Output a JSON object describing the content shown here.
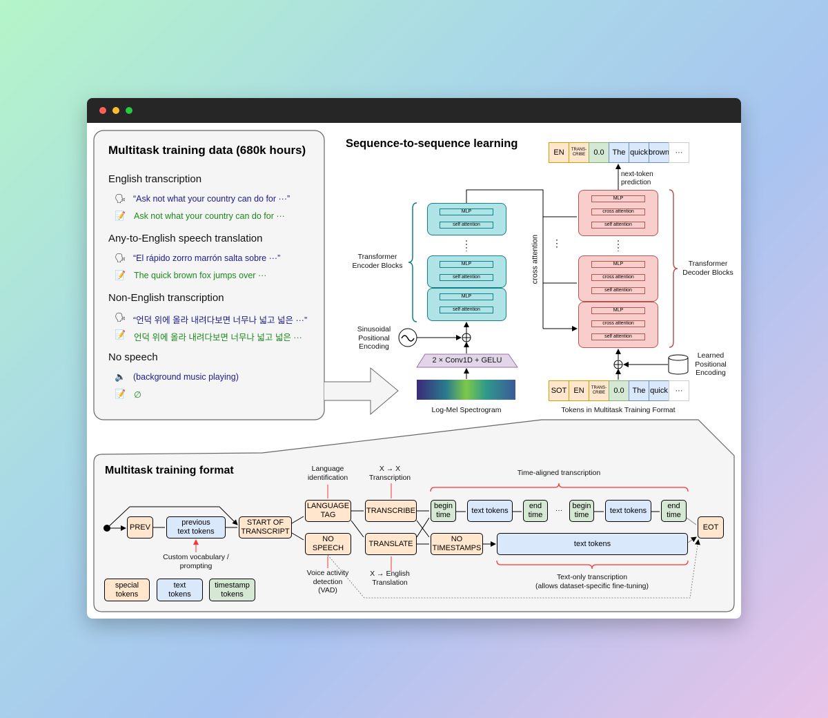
{
  "left_panel": {
    "title": "Multitask training data (680k hours)",
    "sections": [
      {
        "heading": "English transcription",
        "audio": "“Ask not what your country can do for ···”",
        "text": "Ask not what your country can do for ···"
      },
      {
        "heading": "Any-to-English speech translation",
        "audio": "“El rápido zorro marrón salta sobre ···”",
        "text": "The quick brown fox jumps over ···"
      },
      {
        "heading": "Non-English transcription",
        "audio": "“언덕 위에 올라 내려다보면 너무나 넓고 넓은 ···”",
        "text": "언덕 위에 올라 내려다보면 너무나 넓고 넓은 ···"
      },
      {
        "heading": "No speech",
        "audio": "(background music playing)",
        "text": "∅"
      }
    ]
  },
  "seq2seq": {
    "title": "Sequence-to-sequence learning",
    "output_tokens": [
      "EN",
      "TRANS-\nCRIBE",
      "0.0",
      "The",
      "quick",
      "brown",
      "···"
    ],
    "input_tokens": [
      "SOT",
      "EN",
      "TRANS-\nCRIBE",
      "0.0",
      "The",
      "quick",
      "···"
    ],
    "next_token": "next-token\nprediction",
    "encoder_label": "Transformer\nEncoder Blocks",
    "decoder_label": "Transformer\nDecoder Blocks",
    "mlp": "MLP",
    "self_attention": "self attention",
    "cross_attention": "cross attention",
    "cross_attention_label": "cross attention",
    "sinusoidal": "Sinusoidal\nPositional\nEncoding",
    "learned": "Learned\nPositional\nEncoding",
    "conv": "2 × Conv1D + GELU",
    "spectrogram": "Log-Mel Spectrogram",
    "tokens_caption": "Tokens in Multitask Training Format",
    "dots": "⋮"
  },
  "format": {
    "title": "Multitask training format",
    "prev": "PREV",
    "previous": "previous\ntext tokens",
    "sot": "START OF\nTRANSCRIPT",
    "lang": "LANGUAGE\nTAG",
    "nospeech": "NO\nSPEECH",
    "transcribe": "TRANSCRIBE",
    "translate": "TRANSLATE",
    "begin": "begin\ntime",
    "text_tokens": "text tokens",
    "end": "end\ntime",
    "ellipsis": "···",
    "notimestamps": "NO\nTIMESTAMPS",
    "eot": "EOT",
    "lang_id": "Language\nidentification",
    "xx": "X → X\nTranscription",
    "time_aligned": "Time-aligned transcription",
    "custom": "Custom vocabulary /\nprompting",
    "vad": "Voice activity\ndetection\n(VAD)",
    "xen": "X → English\nTranslation",
    "text_only": "Text-only transcription\n(allows dataset-specific fine-tuning)",
    "legend": [
      "special\ntokens",
      "text\ntokens",
      "timestamp\ntokens"
    ]
  },
  "colors": {
    "special": "#ffe6cc",
    "text": "#dae8fc",
    "timestamp": "#d5e8d4",
    "encoder": "#b0e3e6",
    "decoder": "#f8cecc",
    "highlight": "#ff3333"
  }
}
